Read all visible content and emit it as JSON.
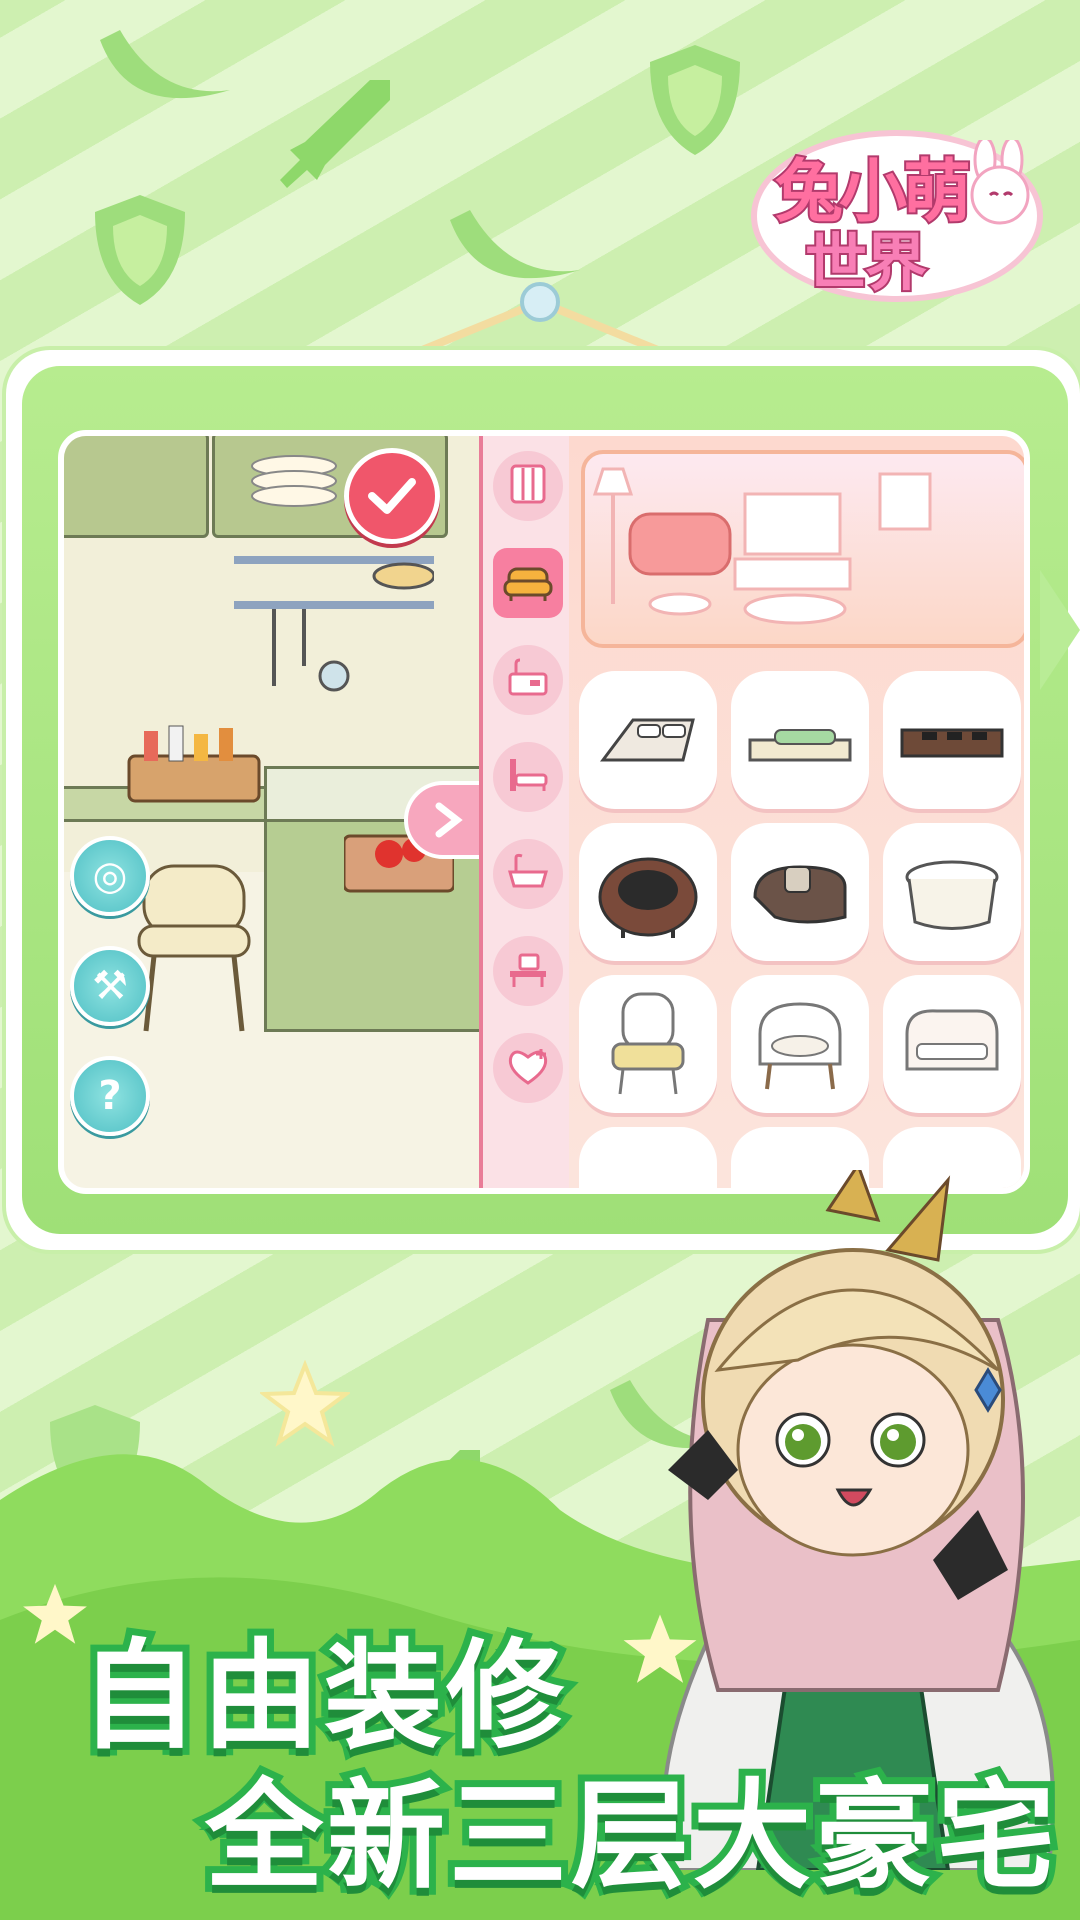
{
  "game": {
    "logo_line1": "兔小萌",
    "logo_line2": "世界"
  },
  "headline": {
    "line1": "自由装修",
    "line2": "全新三层大豪宅"
  },
  "colors": {
    "accent_green": "#2cb24b",
    "accent_pink": "#f77fa0",
    "teal_button": "#4fbfc4",
    "confirm_red": "#f0566b"
  },
  "scene": {
    "tools": [
      {
        "name": "hide-icon",
        "glyph": "◎"
      },
      {
        "name": "hammer-icon",
        "glyph": "⚒"
      },
      {
        "name": "help-icon",
        "glyph": "?"
      }
    ]
  },
  "categories": [
    {
      "name": "wallpaper-icon",
      "active": false
    },
    {
      "name": "sofa-icon",
      "active": true
    },
    {
      "name": "kitchen-icon",
      "active": false
    },
    {
      "name": "bed-icon",
      "active": false
    },
    {
      "name": "bathtub-icon",
      "active": false
    },
    {
      "name": "desk-icon",
      "active": false
    },
    {
      "name": "favorite-icon",
      "active": false
    }
  ],
  "furniture": [
    {
      "name": "gray-bed-item"
    },
    {
      "name": "green-sofa-item"
    },
    {
      "name": "brown-sofa-item"
    },
    {
      "name": "round-chair-item"
    },
    {
      "name": "curved-sofa-item"
    },
    {
      "name": "white-ottoman-item"
    },
    {
      "name": "cream-armchair-item"
    },
    {
      "name": "white-armchair-item"
    },
    {
      "name": "white-loveseat-item"
    }
  ]
}
